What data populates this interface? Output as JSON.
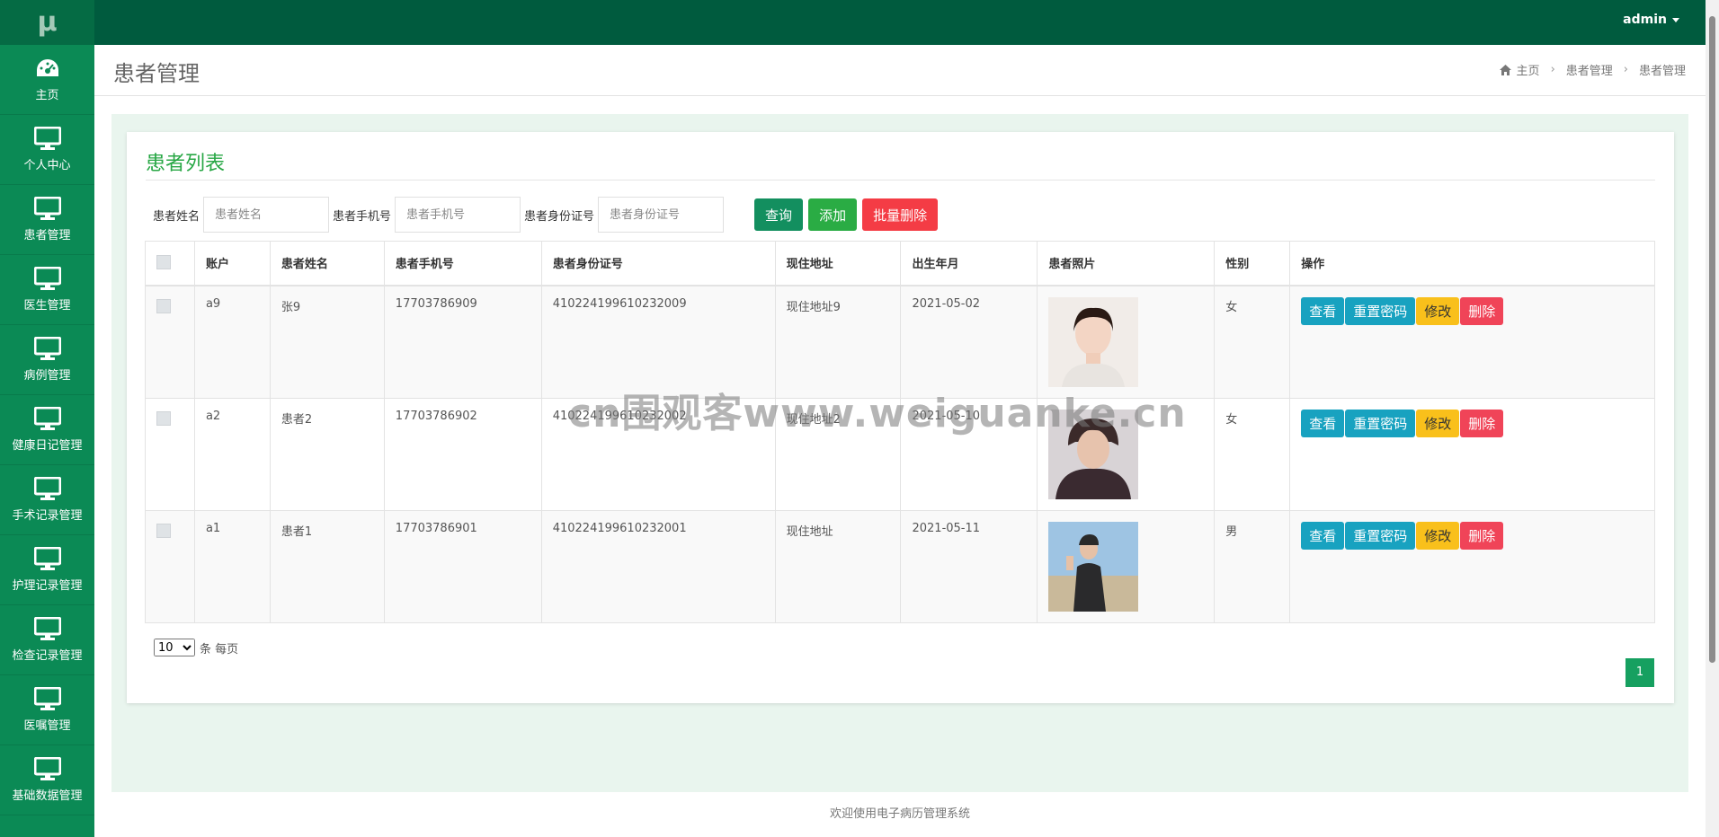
{
  "sidebar": {
    "logo": "μ",
    "items": [
      {
        "label": "主页",
        "icon": "dashboard-icon"
      },
      {
        "label": "个人中心",
        "icon": "monitor-icon"
      },
      {
        "label": "患者管理",
        "icon": "monitor-icon"
      },
      {
        "label": "医生管理",
        "icon": "monitor-icon"
      },
      {
        "label": "病例管理",
        "icon": "monitor-icon"
      },
      {
        "label": "健康日记管理",
        "icon": "monitor-icon"
      },
      {
        "label": "手术记录管理",
        "icon": "monitor-icon"
      },
      {
        "label": "护理记录管理",
        "icon": "monitor-icon"
      },
      {
        "label": "检查记录管理",
        "icon": "monitor-icon"
      },
      {
        "label": "医嘱管理",
        "icon": "monitor-icon"
      },
      {
        "label": "基础数据管理",
        "icon": "monitor-icon"
      }
    ]
  },
  "topbar": {
    "user": "admin"
  },
  "header": {
    "title": "患者管理",
    "breadcrumb": [
      "主页",
      "患者管理",
      "患者管理"
    ]
  },
  "panel": {
    "title": "患者列表",
    "search": {
      "name_label": "患者姓名",
      "name_placeholder": "患者姓名",
      "phone_label": "患者手机号",
      "phone_placeholder": "患者手机号",
      "id_label": "患者身份证号",
      "id_placeholder": "患者身份证号",
      "query": "查询",
      "add": "添加",
      "bulk_delete": "批量删除"
    },
    "columns": [
      "账户",
      "患者姓名",
      "患者手机号",
      "患者身份证号",
      "现住地址",
      "出生年月",
      "患者照片",
      "性别",
      "操作"
    ],
    "rows": [
      {
        "account": "a9",
        "name": "张9",
        "phone": "17703786909",
        "idno": "410224199610232009",
        "address": "现住地址9",
        "birth": "2021-05-02",
        "gender": "女"
      },
      {
        "account": "a2",
        "name": "患者2",
        "phone": "17703786902",
        "idno": "410224199610232002",
        "address": "现住地址2",
        "birth": "2021-05-10",
        "gender": "女"
      },
      {
        "account": "a1",
        "name": "患者1",
        "phone": "17703786901",
        "idno": "410224199610232001",
        "address": "现住地址",
        "birth": "2021-05-11",
        "gender": "男"
      }
    ],
    "actions": {
      "view": "查看",
      "reset": "重置密码",
      "edit": "修改",
      "delete": "删除"
    },
    "pager": {
      "size": "10",
      "size_suffix": "条 每页",
      "page": "1"
    }
  },
  "footer": {
    "text": "欢迎使用电子病历管理系统"
  },
  "watermark": "cn围观客www.weiguanke.cn",
  "colors": {
    "sidebar": "#0b8a55",
    "topbar": "#005b3e",
    "accent": "#28a745"
  }
}
